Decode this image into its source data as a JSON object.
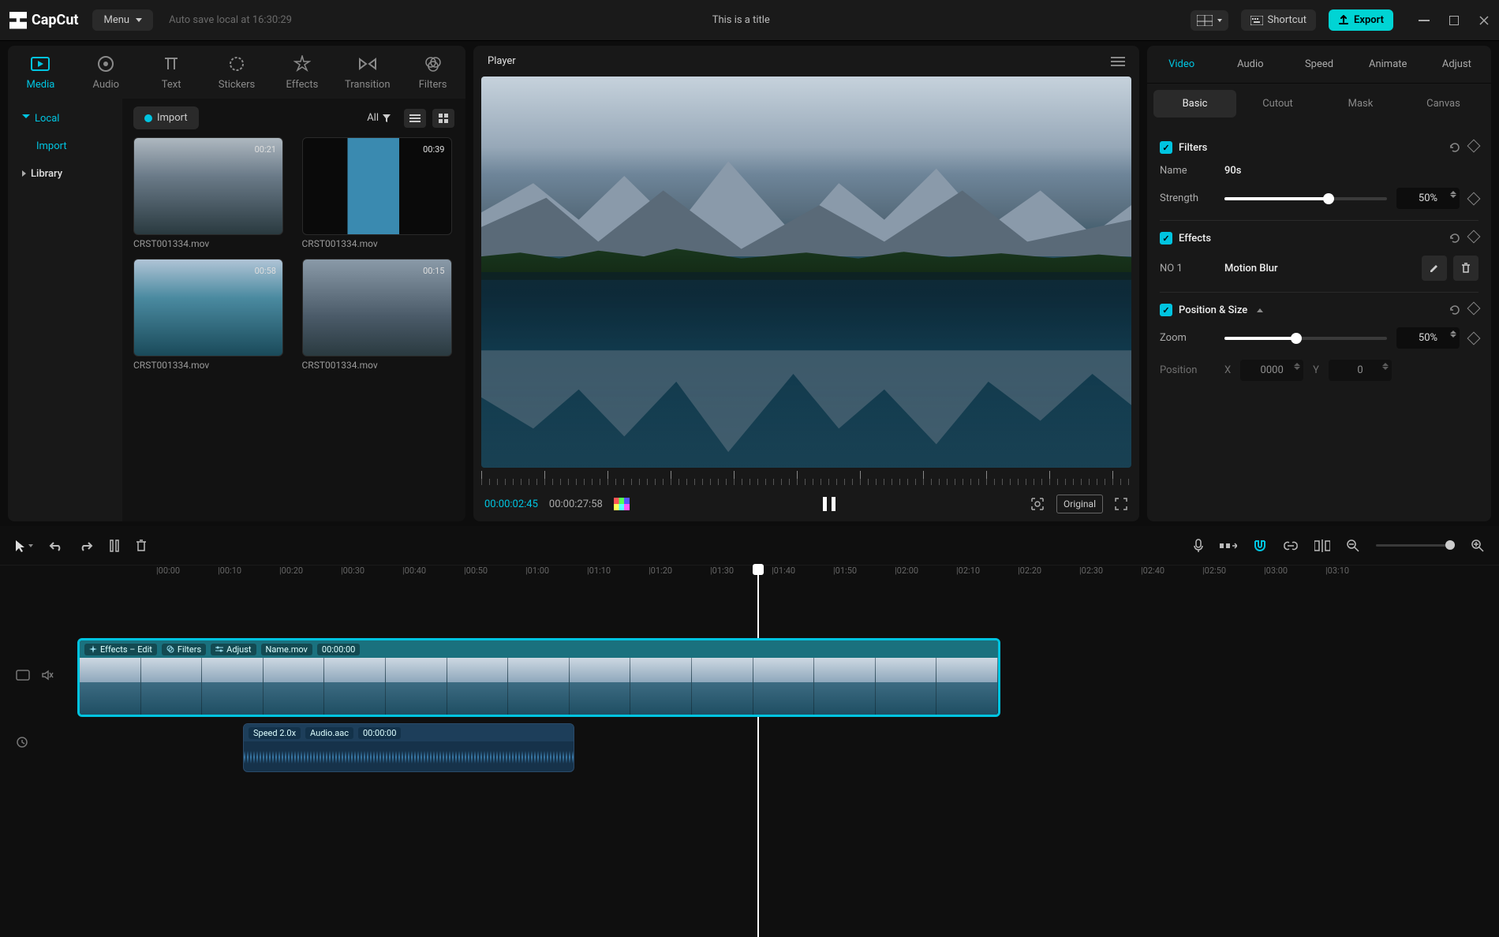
{
  "app": {
    "name": "CapCut",
    "menuLabel": "Menu",
    "autosave": "Auto save local at 16:30:29",
    "title": "This is a title"
  },
  "titlebar": {
    "shortcut": "Shortcut",
    "export": "Export"
  },
  "topTabs": [
    "Media",
    "Audio",
    "Text",
    "Stickers",
    "Effects",
    "Transition",
    "Filters"
  ],
  "sidebar": {
    "local": "Local",
    "import": "Import",
    "library": "Library"
  },
  "library": {
    "importBtn": "Import",
    "all": "All",
    "clips": [
      {
        "name": "CRST001334.mov",
        "dur": "00:21"
      },
      {
        "name": "CRST001334.mov",
        "dur": "00:39"
      },
      {
        "name": "CRST001334.mov",
        "dur": "00:58"
      },
      {
        "name": "CRST001334.mov",
        "dur": "00:15"
      }
    ]
  },
  "player": {
    "label": "Player",
    "tc": "00:00:02:45",
    "dur": "00:00:27:58",
    "original": "Original"
  },
  "inspector": {
    "tabs": [
      "Video",
      "Audio",
      "Speed",
      "Animate",
      "Adjust"
    ],
    "subtabs": [
      "Basic",
      "Cutout",
      "Mask",
      "Canvas"
    ],
    "filters": {
      "title": "Filters",
      "nameLabel": "Name",
      "nameVal": "90s",
      "strengthLabel": "Strength",
      "strengthPct": "50%"
    },
    "effects": {
      "title": "Effects",
      "no": "NO 1",
      "name": "Motion Blur"
    },
    "pos": {
      "title": "Position & Size",
      "zoomLabel": "Zoom",
      "zoomPct": "50%",
      "positionLabel": "Position",
      "xLabel": "X",
      "xVal": "0000",
      "yLabel": "Y",
      "yVal": "0"
    }
  },
  "timeline": {
    "ticks": [
      "00:00",
      "00:10",
      "00:20",
      "00:30",
      "00:40",
      "00:50",
      "01:00",
      "01:10",
      "01:20",
      "01:30",
      "01:40",
      "01:50",
      "02:00",
      "02:10",
      "02:20",
      "02:30",
      "02:40",
      "02:50",
      "03:00",
      "03:10"
    ],
    "videoClip": {
      "effects": "Effects – Edit",
      "filters": "Filters",
      "adjust": "Adjust",
      "name": "Name.mov",
      "tc": "00:00:00"
    },
    "audioClip": {
      "speed": "Speed 2.0x",
      "name": "Audio.aac",
      "tc": "00:00:00"
    }
  }
}
